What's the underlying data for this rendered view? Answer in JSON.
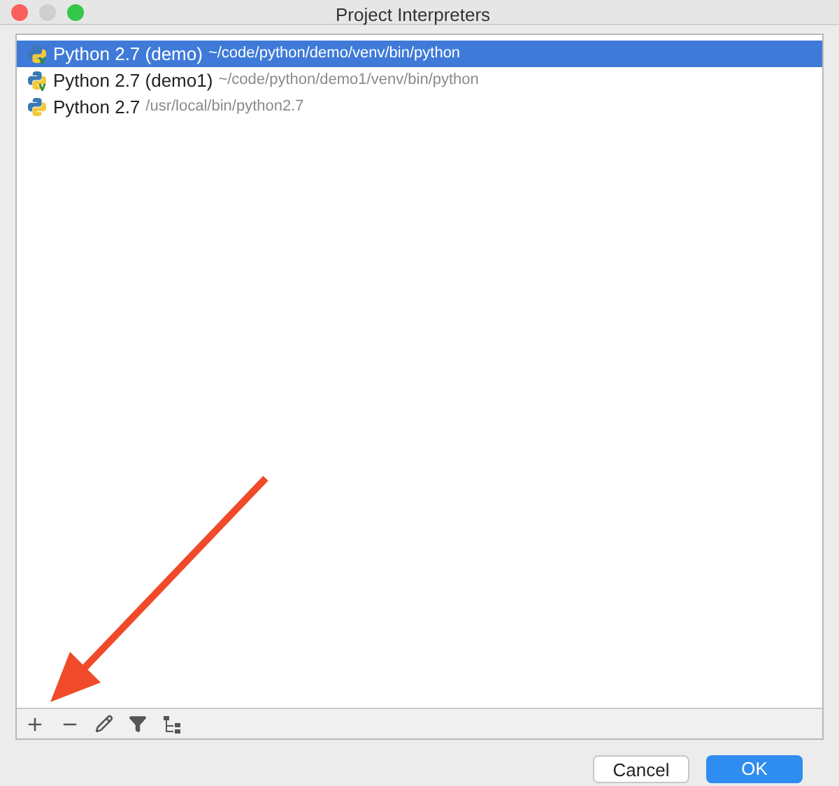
{
  "window": {
    "title": "Project Interpreters"
  },
  "interpreters": [
    {
      "name": "Python 2.7 (demo)",
      "path": "~/code/python/demo/venv/bin/python",
      "virtualenv": true,
      "selected": true
    },
    {
      "name": "Python 2.7 (demo1)",
      "path": "~/code/python/demo1/venv/bin/python",
      "virtualenv": true,
      "selected": false
    },
    {
      "name": "Python 2.7",
      "path": "/usr/local/bin/python2.7",
      "virtualenv": false,
      "selected": false
    }
  ],
  "buttons": [
    {
      "label": "Cancel",
      "kind": "secondary"
    },
    {
      "label": "OK",
      "kind": "primary"
    }
  ]
}
